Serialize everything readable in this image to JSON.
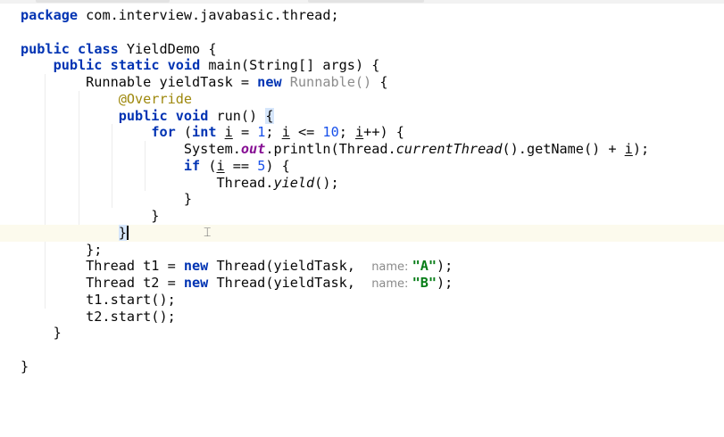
{
  "editor": {
    "file_language": "java",
    "colors": {
      "keyword": "#0033b3",
      "annotation": "#9e880d",
      "number": "#1750eb",
      "string": "#067d17",
      "static_field": "#871094",
      "inlay_hint": "#8a8a8a",
      "caret_line": "#fcfaed",
      "brace_match": "#d6e6fb"
    },
    "caret_line_index": 13,
    "mouse_cursor_icon": "text-ibeam-cursor",
    "lines": [
      {
        "index": 0,
        "tokens": [
          {
            "text": "package",
            "kind": "kw"
          },
          {
            "text": " com.interview.javabasic.thread;"
          }
        ]
      },
      {
        "index": 1,
        "tokens": []
      },
      {
        "index": 2,
        "tokens": [
          {
            "text": "public",
            "kind": "kw"
          },
          {
            "text": " "
          },
          {
            "text": "class",
            "kind": "kw"
          },
          {
            "text": " YieldDemo {"
          }
        ]
      },
      {
        "index": 3,
        "tokens": [
          {
            "text": "    "
          },
          {
            "text": "public",
            "kind": "kw"
          },
          {
            "text": " "
          },
          {
            "text": "static",
            "kind": "kw"
          },
          {
            "text": " "
          },
          {
            "text": "void",
            "kind": "kw"
          },
          {
            "text": " main(String[] args) {"
          }
        ]
      },
      {
        "index": 4,
        "tokens": [
          {
            "text": "        Runnable yieldTask = "
          },
          {
            "text": "new",
            "kind": "kw"
          },
          {
            "text": " "
          },
          {
            "text": "Runnable()",
            "kind": "anon"
          },
          {
            "text": " {"
          }
        ]
      },
      {
        "index": 5,
        "tokens": [
          {
            "text": "            "
          },
          {
            "text": "@Override",
            "kind": "ann"
          }
        ]
      },
      {
        "index": 6,
        "tokens": [
          {
            "text": "            "
          },
          {
            "text": "public",
            "kind": "kw"
          },
          {
            "text": " "
          },
          {
            "text": "void",
            "kind": "kw"
          },
          {
            "text": " run() "
          },
          {
            "text": "{",
            "kind": "brace-match"
          }
        ]
      },
      {
        "index": 7,
        "tokens": [
          {
            "text": "                "
          },
          {
            "text": "for",
            "kind": "kw"
          },
          {
            "text": " ("
          },
          {
            "text": "int",
            "kind": "kw"
          },
          {
            "text": " "
          },
          {
            "text": "i",
            "kind": "underline"
          },
          {
            "text": " = "
          },
          {
            "text": "1",
            "kind": "num"
          },
          {
            "text": "; "
          },
          {
            "text": "i",
            "kind": "underline"
          },
          {
            "text": " <= "
          },
          {
            "text": "10",
            "kind": "num"
          },
          {
            "text": "; "
          },
          {
            "text": "i",
            "kind": "underline"
          },
          {
            "text": "++) {"
          }
        ]
      },
      {
        "index": 8,
        "tokens": [
          {
            "text": "                    System."
          },
          {
            "text": "out",
            "kind": "static-field"
          },
          {
            "text": ".println(Thread."
          },
          {
            "text": "currentThread",
            "kind": "static-call"
          },
          {
            "text": "().getName() + "
          },
          {
            "text": "i",
            "kind": "underline"
          },
          {
            "text": ");"
          }
        ]
      },
      {
        "index": 9,
        "tokens": [
          {
            "text": "                    "
          },
          {
            "text": "if",
            "kind": "kw"
          },
          {
            "text": " ("
          },
          {
            "text": "i",
            "kind": "underline"
          },
          {
            "text": " == "
          },
          {
            "text": "5",
            "kind": "num"
          },
          {
            "text": ") {"
          }
        ]
      },
      {
        "index": 10,
        "tokens": [
          {
            "text": "                        Thread."
          },
          {
            "text": "yield",
            "kind": "static-call"
          },
          {
            "text": "();"
          }
        ]
      },
      {
        "index": 11,
        "tokens": [
          {
            "text": "                    }"
          }
        ]
      },
      {
        "index": 12,
        "tokens": [
          {
            "text": "                }"
          }
        ]
      },
      {
        "index": 13,
        "tokens": [
          {
            "text": "            "
          },
          {
            "text": "}",
            "kind": "brace-match"
          },
          {
            "text": "",
            "kind": "caret"
          }
        ]
      },
      {
        "index": 14,
        "tokens": [
          {
            "text": "        };"
          }
        ]
      },
      {
        "index": 15,
        "tokens": [
          {
            "text": "        Thread t1 = "
          },
          {
            "text": "new",
            "kind": "kw"
          },
          {
            "text": " Thread(yieldTask,  "
          },
          {
            "text": "name: ",
            "kind": "hint"
          },
          {
            "text": "\"A\"",
            "kind": "str"
          },
          {
            "text": ");"
          }
        ]
      },
      {
        "index": 16,
        "tokens": [
          {
            "text": "        Thread t2 = "
          },
          {
            "text": "new",
            "kind": "kw"
          },
          {
            "text": " Thread(yieldTask,  "
          },
          {
            "text": "name: ",
            "kind": "hint"
          },
          {
            "text": "\"B\"",
            "kind": "str"
          },
          {
            "text": ");"
          }
        ]
      },
      {
        "index": 17,
        "tokens": [
          {
            "text": "        t1.start();"
          }
        ]
      },
      {
        "index": 18,
        "tokens": [
          {
            "text": "        t2.start();"
          }
        ]
      },
      {
        "index": 19,
        "tokens": [
          {
            "text": "    }"
          }
        ]
      },
      {
        "index": 20,
        "tokens": []
      },
      {
        "index": 21,
        "tokens": [
          {
            "text": "}"
          }
        ]
      }
    ]
  }
}
